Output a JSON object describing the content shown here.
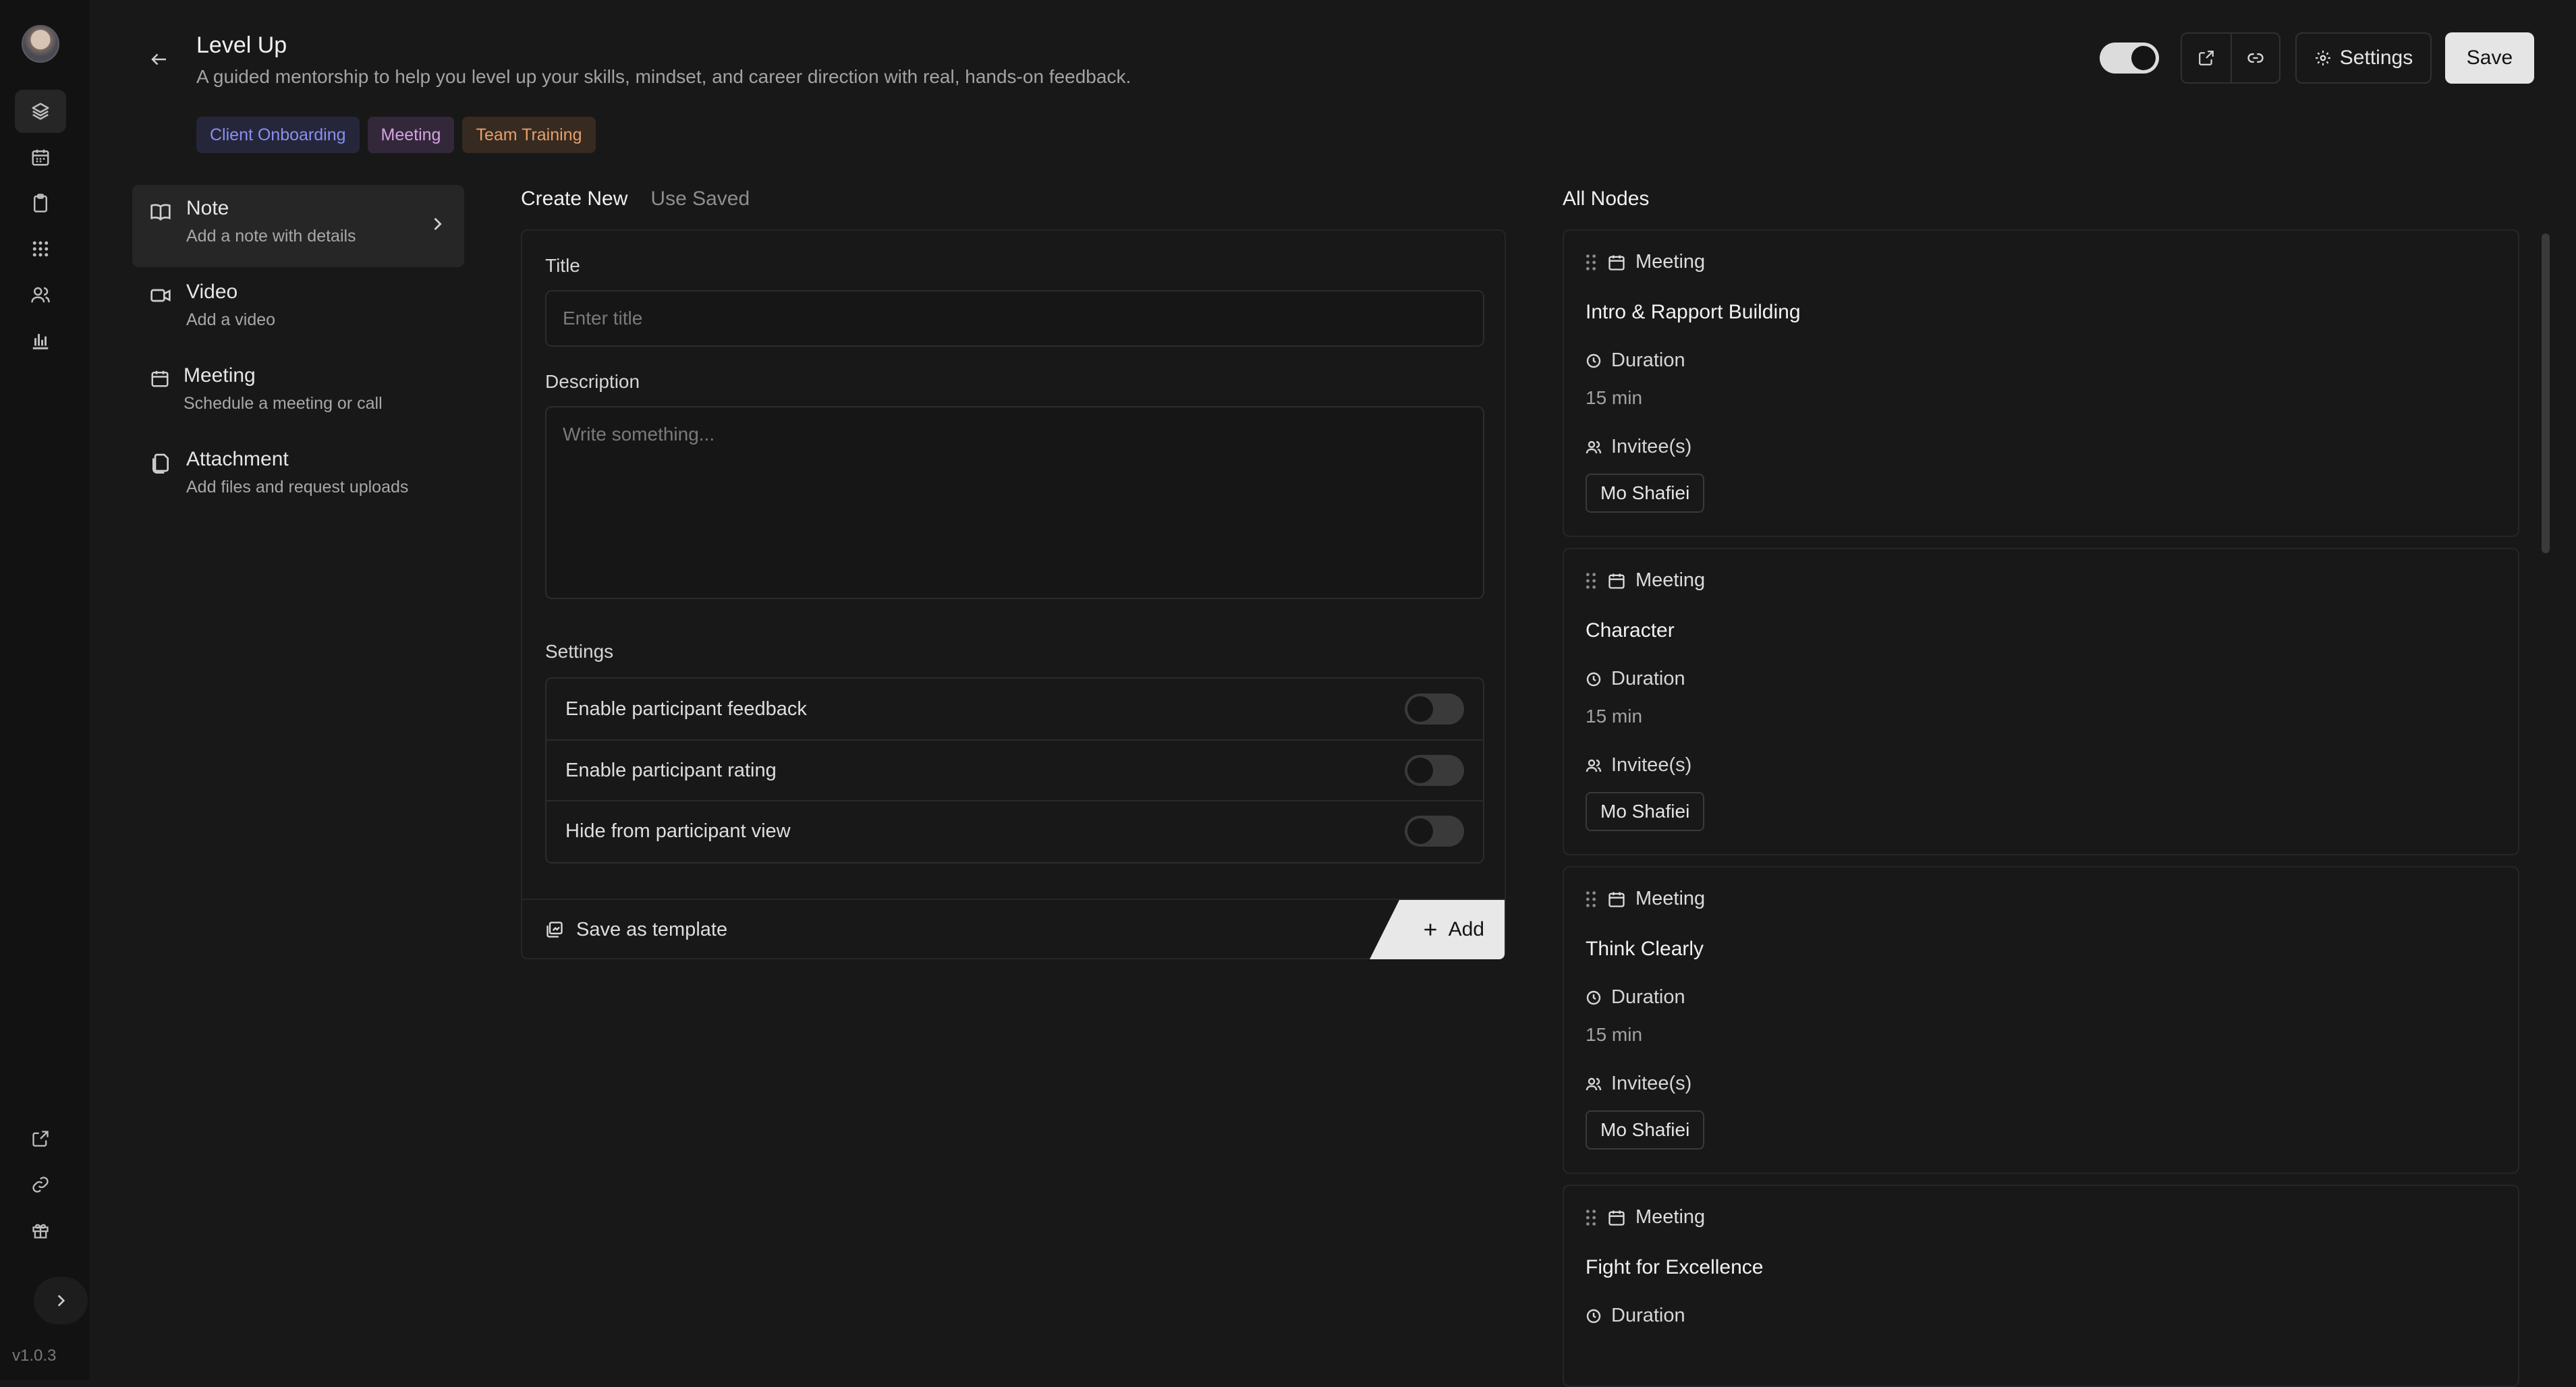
{
  "header": {
    "title": "Level Up",
    "subtitle": "A guided mentorship to help you level up your skills, mindset, and career direction with real, hands-on feedback.",
    "tags": [
      {
        "label": "Client Onboarding",
        "color": "#8a8ff0",
        "bg": "#25263a"
      },
      {
        "label": "Meeting",
        "color": "#d4a3e0",
        "bg": "#33283a"
      },
      {
        "label": "Team Training",
        "color": "#e6a06c",
        "bg": "#372a20"
      }
    ],
    "settings_label": "Settings",
    "save_label": "Save",
    "active_toggle": true
  },
  "sidebar": {
    "items": [
      "layers-icon",
      "calendar-icon",
      "clipboard-icon",
      "grid-icon",
      "users-icon",
      "bar-chart-icon"
    ],
    "bottom": [
      "external-link-icon",
      "link-icon",
      "gift-icon"
    ],
    "version": "v1.0.3"
  },
  "node_types": [
    {
      "title": "Note",
      "desc": "Add a note with details",
      "icon": "book-icon",
      "active": true
    },
    {
      "title": "Video",
      "desc": "Add a video",
      "icon": "video-icon",
      "active": false
    },
    {
      "title": "Meeting",
      "desc": "Schedule a meeting or call",
      "icon": "calendar-icon",
      "active": false
    },
    {
      "title": "Attachment",
      "desc": "Add files and request uploads",
      "icon": "file-icon",
      "active": false
    }
  ],
  "form": {
    "tabs": [
      "Create New",
      "Use Saved"
    ],
    "title_label": "Title",
    "title_placeholder": "Enter title",
    "description_label": "Description",
    "description_placeholder": "Write something...",
    "settings_label": "Settings",
    "settings": [
      {
        "label": "Enable participant feedback",
        "on": false
      },
      {
        "label": "Enable participant rating",
        "on": false
      },
      {
        "label": "Hide from participant view",
        "on": false
      }
    ],
    "save_template_label": "Save as template",
    "add_label": "Add"
  },
  "all_nodes": {
    "title": "All Nodes",
    "nodes": [
      {
        "type": "Meeting",
        "title": "Intro & Rapport Building",
        "duration_label": "Duration",
        "duration": "15 min",
        "invitees_label": "Invitee(s)",
        "invitee": "Mo Shafiei"
      },
      {
        "type": "Meeting",
        "title": "Character",
        "duration_label": "Duration",
        "duration": "15 min",
        "invitees_label": "Invitee(s)",
        "invitee": "Mo Shafiei"
      },
      {
        "type": "Meeting",
        "title": "Think Clearly",
        "duration_label": "Duration",
        "duration": "15 min",
        "invitees_label": "Invitee(s)",
        "invitee": "Mo Shafiei"
      },
      {
        "type": "Meeting",
        "title": "Fight for Excellence",
        "duration_label": "Duration"
      }
    ]
  }
}
